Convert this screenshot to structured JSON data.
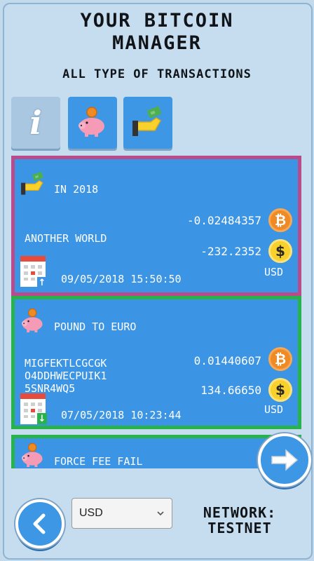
{
  "header": {
    "title_line1": "YOUR BITCOIN",
    "title_line2": "MANAGER",
    "subtitle": "ALL TYPE OF TRANSACTIONS"
  },
  "tabs": [
    {
      "icon": "info-icon",
      "glyph": "i",
      "active": false
    },
    {
      "icon": "piggy-bank-icon",
      "active": true
    },
    {
      "icon": "hand-money-icon",
      "active": true
    }
  ],
  "transactions": [
    {
      "title": "IN 2018",
      "type_icon": "hand-money-icon",
      "description": "ANOTHER WORLD",
      "btc_amount": "-0.02484357",
      "fiat_amount": "-232.2352",
      "currency": "USD",
      "date": "09/05/2018 15:50:50",
      "direction": "up",
      "border_color": "#b94b8c"
    },
    {
      "title": "POUND TO EURO",
      "type_icon": "piggy-bank-icon",
      "description_lines": [
        "MIGFEKTLCGCGK",
        "O4DDHWECPUIK1",
        "5SNR4WQ5"
      ],
      "btc_amount": "0.01440607",
      "fiat_amount": "134.66650",
      "currency": "USD",
      "date": "07/05/2018 10:23:44",
      "direction": "down",
      "border_color": "#28b24b"
    },
    {
      "title": "FORCE FEE FAIL",
      "type_icon": "piggy-bank-icon",
      "border_color": "#28b24b"
    }
  ],
  "footer": {
    "currency_select": {
      "value": "USD",
      "options": [
        "USD"
      ]
    },
    "network_label": "NETWORK:",
    "network_value": "TESTNET"
  },
  "colors": {
    "background": "#c3d9ec",
    "card": "#3b95e4",
    "pink_border": "#b94b8c",
    "green_border": "#28b24b",
    "bitcoin": "#f08a24",
    "dollar": "#f8d12c"
  }
}
